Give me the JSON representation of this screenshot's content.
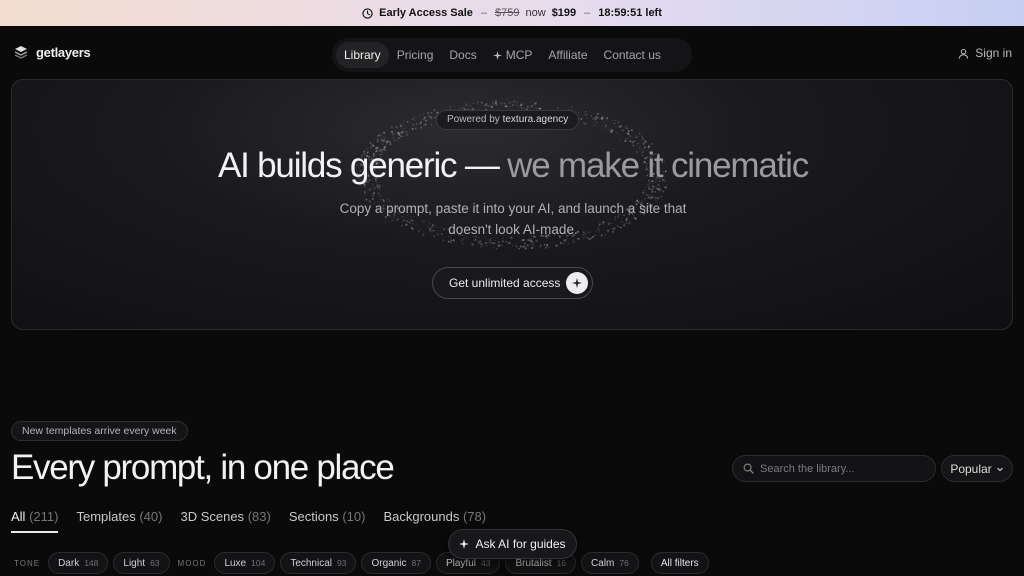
{
  "banner": {
    "label": "Early Access Sale",
    "old_price": "$759",
    "now_label": "now",
    "new_price": "$199",
    "countdown": "18:59:51 left"
  },
  "nav": {
    "logo_text": "getlayers",
    "items": [
      {
        "label": "Library",
        "active": true
      },
      {
        "label": "Pricing"
      },
      {
        "label": "Docs"
      },
      {
        "label": "MCP"
      },
      {
        "label": "Affiliate"
      },
      {
        "label": "Contact us"
      }
    ],
    "signin": "Sign in"
  },
  "hero": {
    "powered_prefix": "Powered by",
    "powered_by": "textura.agency",
    "title_main": "AI builds generic —",
    "title_dim": " we make it cinematic",
    "subtitle": "Copy a prompt, paste it into your AI, and launch a site that doesn't look AI-made.",
    "cta": "Get unlimited access"
  },
  "library": {
    "badge": "New templates arrive every week",
    "title": "Every prompt, in one place",
    "search_placeholder": "Search the library...",
    "sort": "Popular",
    "tabs": [
      {
        "label": "All",
        "count": "(211)",
        "active": true
      },
      {
        "label": "Templates",
        "count": "(40)"
      },
      {
        "label": "3D Scenes",
        "count": "(83)"
      },
      {
        "label": "Sections",
        "count": "(10)"
      },
      {
        "label": "Backgrounds",
        "count": "(78)"
      }
    ],
    "filter_groups": [
      {
        "label": "TONE",
        "chips": [
          {
            "label": "Dark",
            "count": "148"
          },
          {
            "label": "Light",
            "count": "63"
          }
        ]
      },
      {
        "label": "MOOD",
        "chips": [
          {
            "label": "Luxe",
            "count": "104"
          },
          {
            "label": "Technical",
            "count": "93"
          },
          {
            "label": "Organic",
            "count": "87"
          },
          {
            "label": "Playful",
            "count": "43"
          },
          {
            "label": "Brutalist",
            "count": "16"
          },
          {
            "label": "Calm",
            "count": "76"
          }
        ]
      }
    ],
    "all_filters": "All filters"
  },
  "ask_ai": "Ask AI for guides",
  "colors": {
    "background": "#0a0a0b",
    "accent_text": "#f2f2f4",
    "banner_from": "#f3ddd0",
    "banner_to": "#c6cff3"
  }
}
